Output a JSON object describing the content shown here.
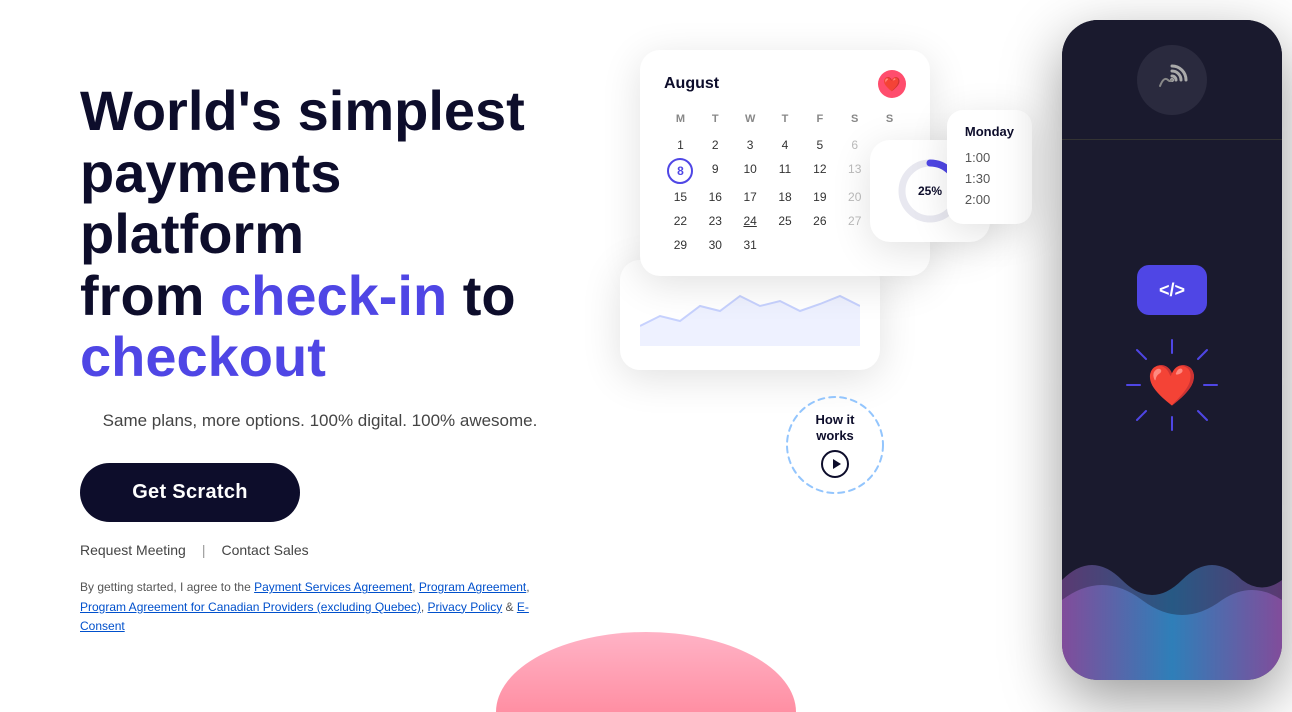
{
  "hero": {
    "title_line1": "World's simplest",
    "title_line2": "payments platform",
    "title_line3_prefix": "from ",
    "title_highlight1": "check-in",
    "title_line3_mid": " to",
    "title_highlight2": "checkout",
    "subtitle": "Same plans, more options. 100% digital. 100% awesome.",
    "cta_label": "Get Scratch",
    "link1": "Request Meeting",
    "link2": "Contact Sales",
    "divider": "|",
    "legal_prefix": "By getting started, I agree to the ",
    "legal_link1": "Payment Services Agreement",
    "legal_comma1": ", ",
    "legal_link2": "Program Agreement",
    "legal_comma2": ", ",
    "legal_link3": "Program Agreement for Canadian Providers (excluding Quebec)",
    "legal_comma3": ", ",
    "legal_link4": "Privacy Policy",
    "legal_amp": " & ",
    "legal_link5": "E-Consent"
  },
  "calendar": {
    "month": "August",
    "day_labels": [
      "M",
      "T",
      "W",
      "T",
      "F",
      "S",
      "S"
    ],
    "today": "8",
    "progress_pct": "25%"
  },
  "times_card": {
    "day": "Monday",
    "times": [
      "1:00",
      "1:30",
      "2:00"
    ]
  },
  "how_it_works": {
    "title": "How it\nworks"
  },
  "icons": {
    "heart_emoji": "❤️",
    "contactless_symbol": "📶",
    "code_symbol": "</>",
    "play_symbol": "▶"
  }
}
